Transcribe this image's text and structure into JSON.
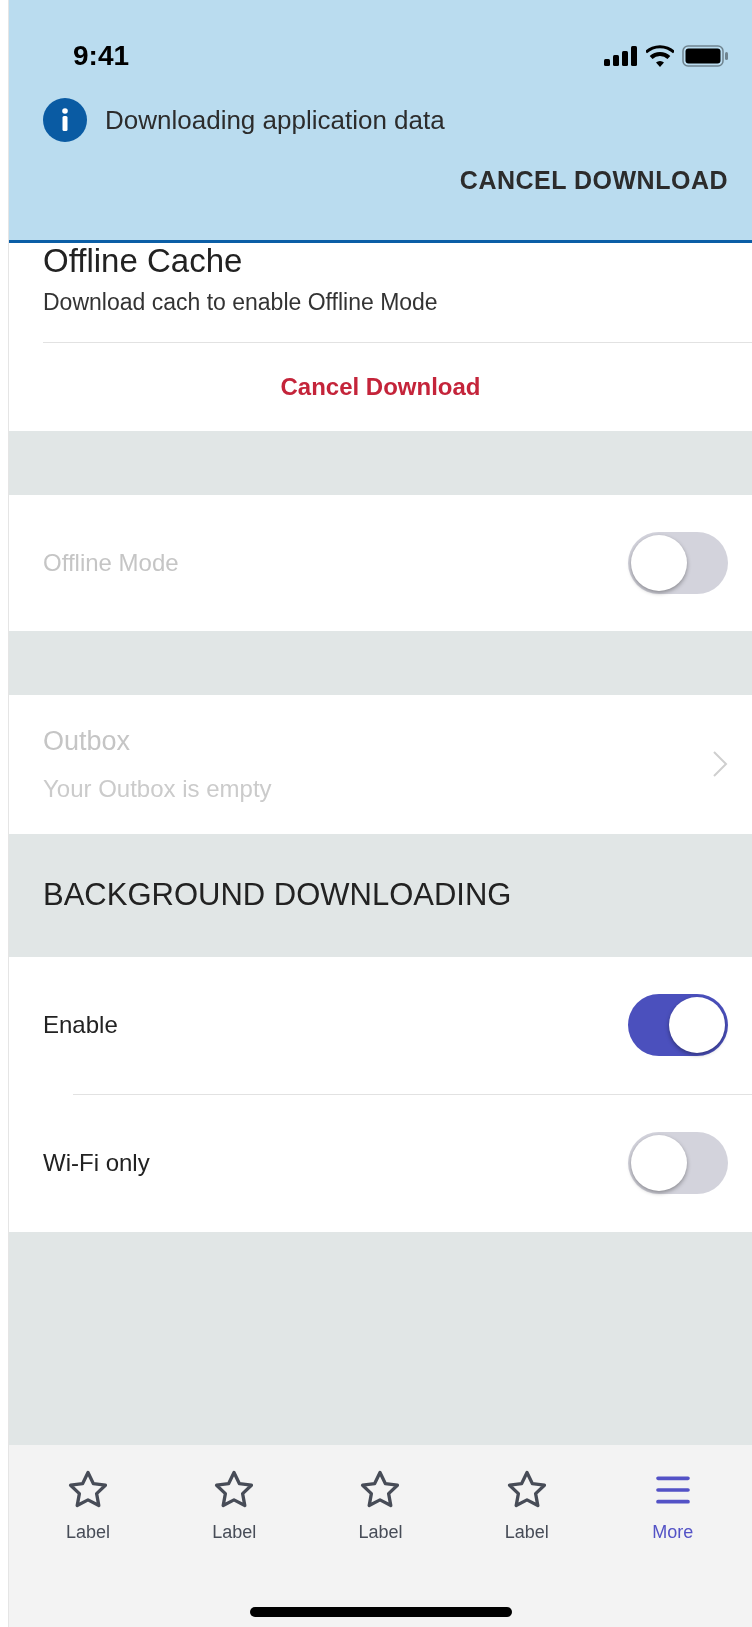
{
  "status_bar": {
    "time": "9:41"
  },
  "banner": {
    "message": "Downloading application data",
    "action": "CANCEL DOWNLOAD"
  },
  "offline_cache": {
    "title": "Offline Cache",
    "subtitle": "Download cach to enable Offline Mode",
    "action": "Cancel Download"
  },
  "offline_mode": {
    "label": "Offline Mode",
    "on": false,
    "disabled": true
  },
  "outbox": {
    "title": "Outbox",
    "subtitle": "Your Outbox is empty",
    "disabled": true
  },
  "background_downloading": {
    "heading": "BACKGROUND DOWNLOADING",
    "rows": [
      {
        "label": "Enable",
        "on": true
      },
      {
        "label": "Wi-Fi only",
        "on": false
      }
    ]
  },
  "tab_bar": [
    {
      "label": "Label",
      "kind": "star",
      "selected": false
    },
    {
      "label": "Label",
      "kind": "star",
      "selected": false
    },
    {
      "label": "Label",
      "kind": "star",
      "selected": false
    },
    {
      "label": "Label",
      "kind": "star",
      "selected": false
    },
    {
      "label": "More",
      "kind": "menu",
      "selected": true
    }
  ]
}
